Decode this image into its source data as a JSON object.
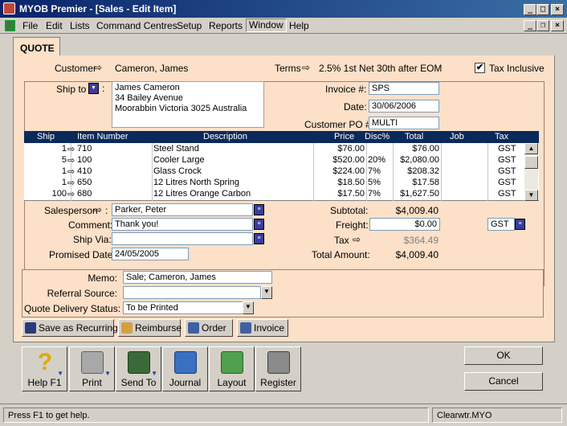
{
  "window": {
    "title": "MYOB Premier - [Sales - Edit Item]"
  },
  "menu": [
    "File",
    "Edit",
    "Lists",
    "Command Centres",
    "Setup",
    "Reports",
    "Window",
    "Help"
  ],
  "tab": "QUOTE",
  "header": {
    "customer_label": "Customer",
    "customer": "Cameron, James",
    "terms_label": "Terms",
    "terms": "2.5% 1st Net 30th after EOM",
    "tax_inclusive_label": "Tax Inclusive",
    "tax_inclusive_checked": "✔"
  },
  "shipto": {
    "label": "Ship to",
    "address": [
      "James Cameron",
      "34 Bailey Avenue",
      "Moorabbin  Victoria  3025  Australia"
    ]
  },
  "invoice": {
    "invoice_no_label": "Invoice #:",
    "invoice_no": "SPS",
    "date_label": "Date:",
    "date": "30/06/2006",
    "po_label": "Customer PO #:",
    "po": "MULTI"
  },
  "table": {
    "headers": [
      "Ship",
      "Item Number",
      "Description",
      "Price",
      "Disc%",
      "Total",
      "Job",
      "Tax"
    ],
    "rows": [
      {
        "ship": "1",
        "item": "710",
        "desc": "Steel Stand",
        "price": "$76.00",
        "disc": "",
        "total": "$76.00",
        "job": "",
        "tax": "GST"
      },
      {
        "ship": "5",
        "item": "100",
        "desc": "Cooler Large",
        "price": "$520.00",
        "disc": "20%",
        "total": "$2,080.00",
        "job": "",
        "tax": "GST"
      },
      {
        "ship": "1",
        "item": "410",
        "desc": "Glass Crock",
        "price": "$224.00",
        "disc": "7%",
        "total": "$208.32",
        "job": "",
        "tax": "GST"
      },
      {
        "ship": "1",
        "item": "650",
        "desc": "12 Litres North Spring",
        "price": "$18.50",
        "disc": "5%",
        "total": "$17.58",
        "job": "",
        "tax": "GST"
      },
      {
        "ship": "100",
        "item": "680",
        "desc": "12 Litres Orange Carbon",
        "price": "$17.50",
        "disc": "7%",
        "total": "$1,627.50",
        "job": "",
        "tax": "GST"
      }
    ]
  },
  "details": {
    "salesperson_label": "Salesperson",
    "salesperson": "Parker, Peter",
    "comment_label": "Comment:",
    "comment": "Thank you!",
    "shipvia_label": "Ship Via:",
    "shipvia": "",
    "promised_label": "Promised Date:",
    "promised": "24/05/2005"
  },
  "totals": {
    "subtotal_label": "Subtotal:",
    "subtotal": "$4,009.40",
    "freight_label": "Freight:",
    "freight": "$0.00",
    "freight_tax": "GST",
    "tax_label": "Tax",
    "tax": "$364.49",
    "total_label": "Total Amount:",
    "total": "$4,009.40"
  },
  "lower": {
    "memo_label": "Memo:",
    "memo": "Sale; Cameron, James",
    "referral_label": "Referral Source:",
    "referral": "",
    "delivery_label": "Quote Delivery Status:",
    "delivery": "To be Printed"
  },
  "actions": [
    "Save as Recurring",
    "Reimburse",
    "Order",
    "Invoice"
  ],
  "toolbar": [
    "Help F1",
    "Print",
    "Send To",
    "Journal",
    "Layout",
    "Register"
  ],
  "ok": "OK",
  "cancel": "Cancel",
  "status": {
    "help": "Press F1 to get help.",
    "file": "Clearwtr.MYO"
  }
}
